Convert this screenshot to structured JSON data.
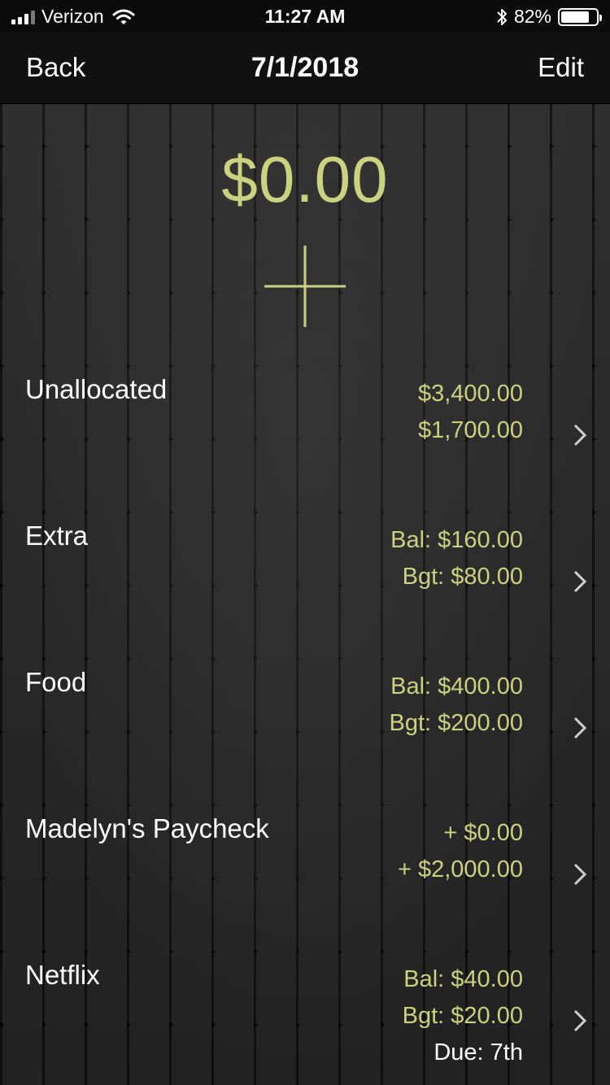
{
  "status_bar": {
    "carrier": "Verizon",
    "time": "11:27 AM",
    "battery_percent": "82%",
    "battery_level": 0.82,
    "icons": [
      "signal-icon",
      "wifi-icon",
      "bluetooth-icon",
      "battery-icon"
    ]
  },
  "nav": {
    "back_label": "Back",
    "title": "7/1/2018",
    "edit_label": "Edit"
  },
  "summary": {
    "total": "$0.00",
    "add_icon": "plus-icon"
  },
  "accent_color": "#c8d27f",
  "rows": [
    {
      "name": "Unallocated",
      "line1": "$3,400.00",
      "line2": "$1,700.00"
    },
    {
      "name": "Extra",
      "line1": "Bal: $160.00",
      "line2": "Bgt: $80.00"
    },
    {
      "name": "Food",
      "line1": "Bal: $400.00",
      "line2": "Bgt: $200.00"
    },
    {
      "name": "Madelyn's Paycheck",
      "line1": "+ $0.00",
      "line2": "+ $2,000.00"
    },
    {
      "name": "Netflix",
      "line1": "Bal: $40.00",
      "line2": "Bgt: $20.00",
      "line3": "Due: 7th"
    }
  ]
}
